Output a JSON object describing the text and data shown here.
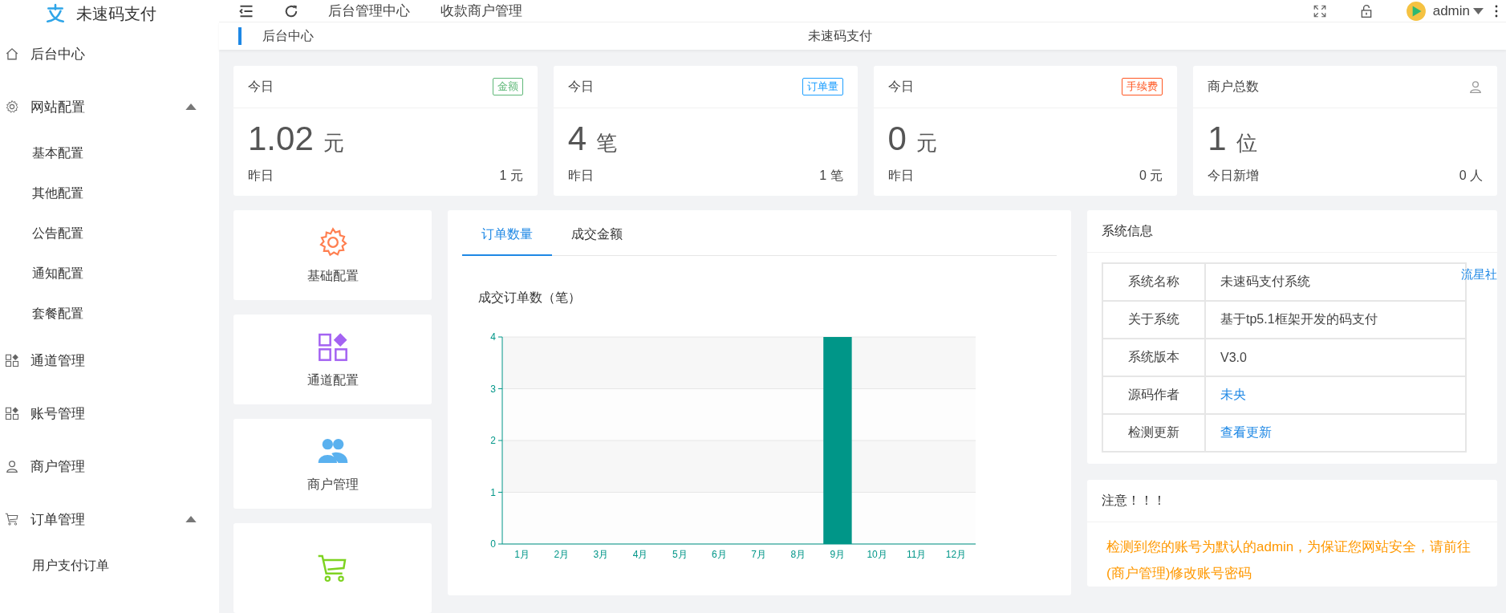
{
  "brand": {
    "name": "未速码支付"
  },
  "sidebar": {
    "items": [
      {
        "label": "后台中心"
      },
      {
        "label": "网站配置",
        "expanded": true,
        "children": [
          {
            "label": "基本配置"
          },
          {
            "label": "其他配置"
          },
          {
            "label": "公告配置"
          },
          {
            "label": "通知配置"
          },
          {
            "label": "套餐配置"
          }
        ]
      },
      {
        "label": "通道管理"
      },
      {
        "label": "账号管理"
      },
      {
        "label": "商户管理"
      },
      {
        "label": "订单管理",
        "expanded": true,
        "children": [
          {
            "label": "用户支付订单"
          }
        ]
      }
    ]
  },
  "header": {
    "nav": [
      "后台管理中心",
      "收款商户管理"
    ],
    "user": "admin"
  },
  "breadcrumb": {
    "current": "后台中心",
    "site": "未速码支付"
  },
  "stat_cards": [
    {
      "title": "今日",
      "badge": "金额",
      "color": "#5fb878",
      "value": "1.02",
      "unit": "元",
      "footer_label": "昨日",
      "footer_value": "1 元"
    },
    {
      "title": "今日",
      "badge": "订单量",
      "color": "#1e9fff",
      "value": "4",
      "unit": "笔",
      "footer_label": "昨日",
      "footer_value": "1 笔"
    },
    {
      "title": "今日",
      "badge": "手续费",
      "color": "#ff5722",
      "value": "0",
      "unit": "元",
      "footer_label": "昨日",
      "footer_value": "0 元"
    },
    {
      "title": "商户总数",
      "value": "1",
      "unit": "位",
      "footer_label": "今日新增",
      "footer_value": "0 人"
    }
  ],
  "shortcuts": [
    {
      "kind": "labeled",
      "label": "基础配置"
    },
    {
      "kind": "labeled",
      "label": "通道配置"
    },
    {
      "kind": "labeled",
      "label": "商户管理"
    },
    {
      "kind": "icon_only"
    }
  ],
  "chart_panel": {
    "tabs": [
      {
        "label": "订单数量",
        "selected": true
      },
      {
        "label": "成交金额",
        "selected": false
      }
    ],
    "chart_data": {
      "type": "bar",
      "title": "成交订单数（笔）",
      "categories": [
        "1月",
        "2月",
        "3月",
        "4月",
        "5月",
        "6月",
        "7月",
        "8月",
        "9月",
        "10月",
        "11月",
        "12月"
      ],
      "series": [
        {
          "color": "#009688",
          "values": [
            0,
            0,
            0,
            0,
            0,
            0,
            0,
            0,
            4,
            0,
            0,
            0
          ]
        }
      ],
      "ylim": [
        0,
        4
      ],
      "yticks": [
        0,
        1,
        2,
        3,
        4
      ],
      "grid": true
    }
  },
  "system_info": {
    "title": "系统信息",
    "floating_link": "流星社",
    "rows": [
      {
        "label": "系统名称",
        "value": "未速码支付系统",
        "kind": "text"
      },
      {
        "label": "关于系统",
        "value": "基于tp5.1框架开发的码支付",
        "kind": "text"
      },
      {
        "label": "系统版本",
        "value": "V3.0",
        "kind": "text"
      },
      {
        "label": "源码作者",
        "value": "未央",
        "kind": "link"
      },
      {
        "label": "检测更新",
        "value": "查看更新",
        "kind": "link"
      }
    ]
  },
  "notice": {
    "title": "注意！！！",
    "message": "检测到您的账号为默认的admin，为保证您网站安全，请前往(商户管理)修改账号密码"
  }
}
